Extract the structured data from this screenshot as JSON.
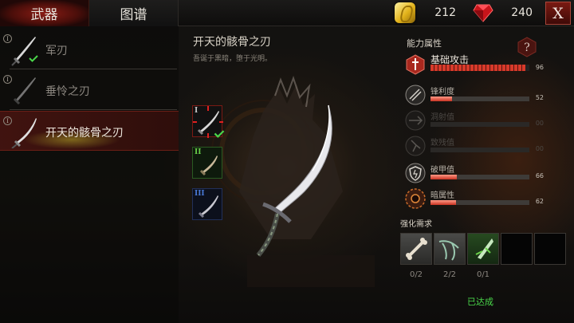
{
  "tabs": {
    "weapons": "武器",
    "atlas": "图谱"
  },
  "currency": {
    "gold": "212",
    "gems": "240",
    "close_label": "X"
  },
  "weapon_list": [
    {
      "tier": "I",
      "name": "军刃",
      "owned": true
    },
    {
      "tier": "I",
      "name": "垂怜之刃",
      "owned": false
    },
    {
      "tier": "I",
      "name": "开天的骸骨之刃",
      "owned": false,
      "selected": true
    }
  ],
  "weapon": {
    "title": "开天的骸骨之刃",
    "description": "吾诞于黑暗，堕于光明。",
    "tiers": [
      {
        "label": "I",
        "color": "#c8c8c8"
      },
      {
        "label": "II",
        "color": "#6ad24a"
      },
      {
        "label": "III",
        "color": "#4a7ad8"
      }
    ]
  },
  "attributes": {
    "title": "能力属性",
    "help_label": "?",
    "items": [
      {
        "name": "基础攻击",
        "value": "96",
        "percent": 96
      },
      {
        "name": "锋利度",
        "value": "52",
        "percent": 22
      },
      {
        "name": "洞射值",
        "value": "00",
        "percent": 0
      },
      {
        "name": "致残值",
        "value": "00",
        "percent": 0
      },
      {
        "name": "破甲值",
        "value": "66",
        "percent": 27
      },
      {
        "name": "暗属性",
        "value": "62",
        "percent": 26
      }
    ]
  },
  "requirements": {
    "title": "强化需求",
    "counts": [
      "0/2",
      "2/2",
      "0/1"
    ],
    "status": "已达成"
  }
}
